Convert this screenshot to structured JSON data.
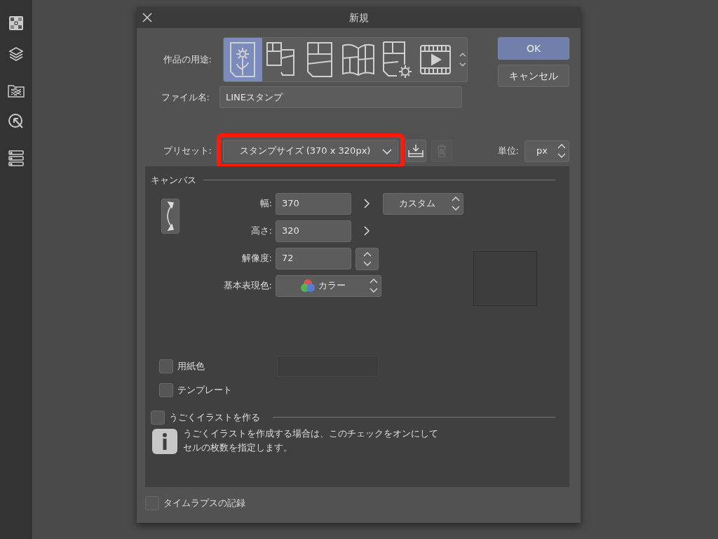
{
  "dialog": {
    "title": "新規"
  },
  "usage": {
    "label": "作品の用途:",
    "options": [
      {
        "kind": "illustration",
        "selected": true
      },
      {
        "kind": "comic",
        "selected": false
      },
      {
        "kind": "page",
        "selected": false
      },
      {
        "kind": "book",
        "selected": false
      },
      {
        "kind": "page-settings",
        "selected": false
      },
      {
        "kind": "animation",
        "selected": false
      }
    ]
  },
  "buttons": [
    {
      "label": "OK",
      "kind": "primary"
    },
    {
      "label": "キャンセル",
      "kind": "secondary"
    }
  ],
  "file_name": {
    "label": "ファイル名:",
    "value": "LINEスタンプ"
  },
  "preset": {
    "label": "プリセット:",
    "value": "スタンプサイズ (370 x 320px)",
    "highlighted": true
  },
  "unit": {
    "label": "単位:",
    "value": "px"
  },
  "canvas": {
    "heading": "キャンバス",
    "width": {
      "label": "幅:",
      "value": "370"
    },
    "height": {
      "label": "高さ:",
      "value": "320"
    },
    "size_preset": "カスタム",
    "resolution": {
      "label": "解像度:",
      "value": "72"
    },
    "color_mode": {
      "label": "基本表現色:",
      "value": "カラー"
    },
    "paper_color": {
      "label": "用紙色",
      "checked": false
    },
    "template": {
      "label": "テンプレート",
      "checked": false
    }
  },
  "animation": {
    "label": "うごくイラストを作る",
    "checked": false,
    "info": [
      "うごくイラストを作成する場合は、このチェックをオンにして",
      "セルの枚数を指定します。"
    ]
  },
  "timelapse": {
    "label": "タイムラプスの記録",
    "checked": false
  }
}
